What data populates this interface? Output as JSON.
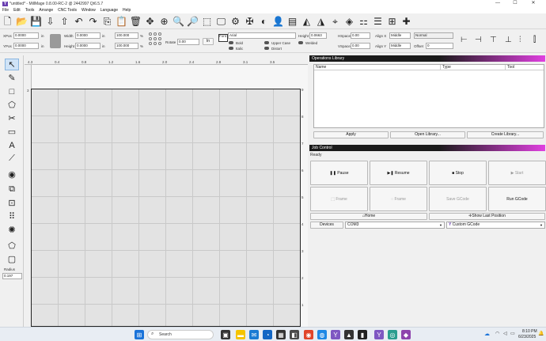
{
  "window": {
    "title": "*untitled* - MillMage 0.8.00-RC-2 @ 2442997 Qt6.5.7",
    "logo": "Y",
    "minimize": "—",
    "maximize": "☐",
    "close": "✕"
  },
  "menu": [
    "File",
    "Edit",
    "Tools",
    "Arrange",
    "CNC Tools",
    "Window",
    "Language",
    "Help"
  ],
  "toolbar_icons": [
    "new-file-icon",
    "open-folder-icon",
    "save-icon",
    "import-icon",
    "export-icon",
    "undo-icon",
    "redo-icon",
    "copy-icon",
    "paste-icon",
    "delete-icon",
    "move-icon",
    "zoom-fit-icon",
    "zoom-in-icon",
    "zoom-out-icon",
    "frame-icon",
    "monitor-icon",
    "settings-icon",
    "machine-settings-icon",
    "camera-icon",
    "user-icon",
    "align-icon",
    "mirror-icon",
    "triangle-icon",
    "target-icon",
    "node-icon",
    "arrange-icon",
    "distribute-icon",
    "grid-icon",
    "plus-icon"
  ],
  "props": {
    "xpos_label": "XPos",
    "xpos": "0.0000",
    "ypos_label": "YPos",
    "ypos": "0.0000",
    "unit": "in",
    "width_label": "Width",
    "width": "0.0000",
    "height_label": "Height",
    "height": "0.0000",
    "pct_w": "100.000",
    "pct_h": "100.000",
    "pct": "%",
    "rotate_label": "Rotate",
    "rotate": "0.00",
    "rotate_unit": "In",
    "font_label": "Font",
    "font": "Arial",
    "text_height_label": "Height",
    "text_height": "0.0663",
    "hspace_label": "HSpace",
    "hspace": "0.00",
    "vspace_label": "VSpace",
    "vspace": "0.00",
    "alignx_label": "Align X",
    "alignx": "Middle",
    "aligny_label": "Align Y",
    "aligny": "Middle",
    "normal": "Normal",
    "offset_label": "Offset",
    "offset": "0",
    "bold": "Bold",
    "italic": "Italic",
    "upper": "Upper Case",
    "distort": "Distort",
    "welded": "Welded"
  },
  "lefttools": {
    "radius_label": "Radius",
    "radius": "0.197",
    "glyphs": [
      "↖",
      "✎",
      "□",
      "⬠",
      "✂",
      "▭",
      "A",
      "⟋",
      "◉",
      "⧉",
      "⊡",
      "⠿",
      "✺",
      "⬠",
      "▢"
    ]
  },
  "ruler": {
    "top": [
      "4.3",
      "0.4",
      "0.8",
      "1.2",
      "1.6",
      "2.0",
      "2.4",
      "2.8",
      "3.1",
      "3.5"
    ],
    "left": [
      "3",
      "",
      "",
      "",
      "",
      "",
      "",
      "",
      ""
    ],
    "right": [
      "9",
      "8",
      "7",
      "6",
      "5",
      "4",
      "3",
      "2",
      "1",
      "0"
    ]
  },
  "ops": {
    "title": "Operations Library",
    "cols": [
      "Name",
      "Type",
      "Tool"
    ],
    "apply": "Apply",
    "open": "Open Library...",
    "create": "Create Library..."
  },
  "job": {
    "title": "Job Control",
    "status": "Ready",
    "pause": "Pause",
    "resume": "Resume",
    "stop": "Stop",
    "start": "Start",
    "frame1": "Frame",
    "frame2": "Frame",
    "save_gcode": "Save GCode",
    "run_gcode": "Run GCode",
    "home": "Home",
    "show_last": "Show Last Position",
    "devices": "Devices",
    "port": "COM3",
    "device": "Custom GCode"
  },
  "taskbar": {
    "search": "Search",
    "time": "8:10 PM",
    "date": "6/23/2025"
  },
  "colors": {
    "accent": "#e040e0",
    "board": "#e3e3e3"
  }
}
